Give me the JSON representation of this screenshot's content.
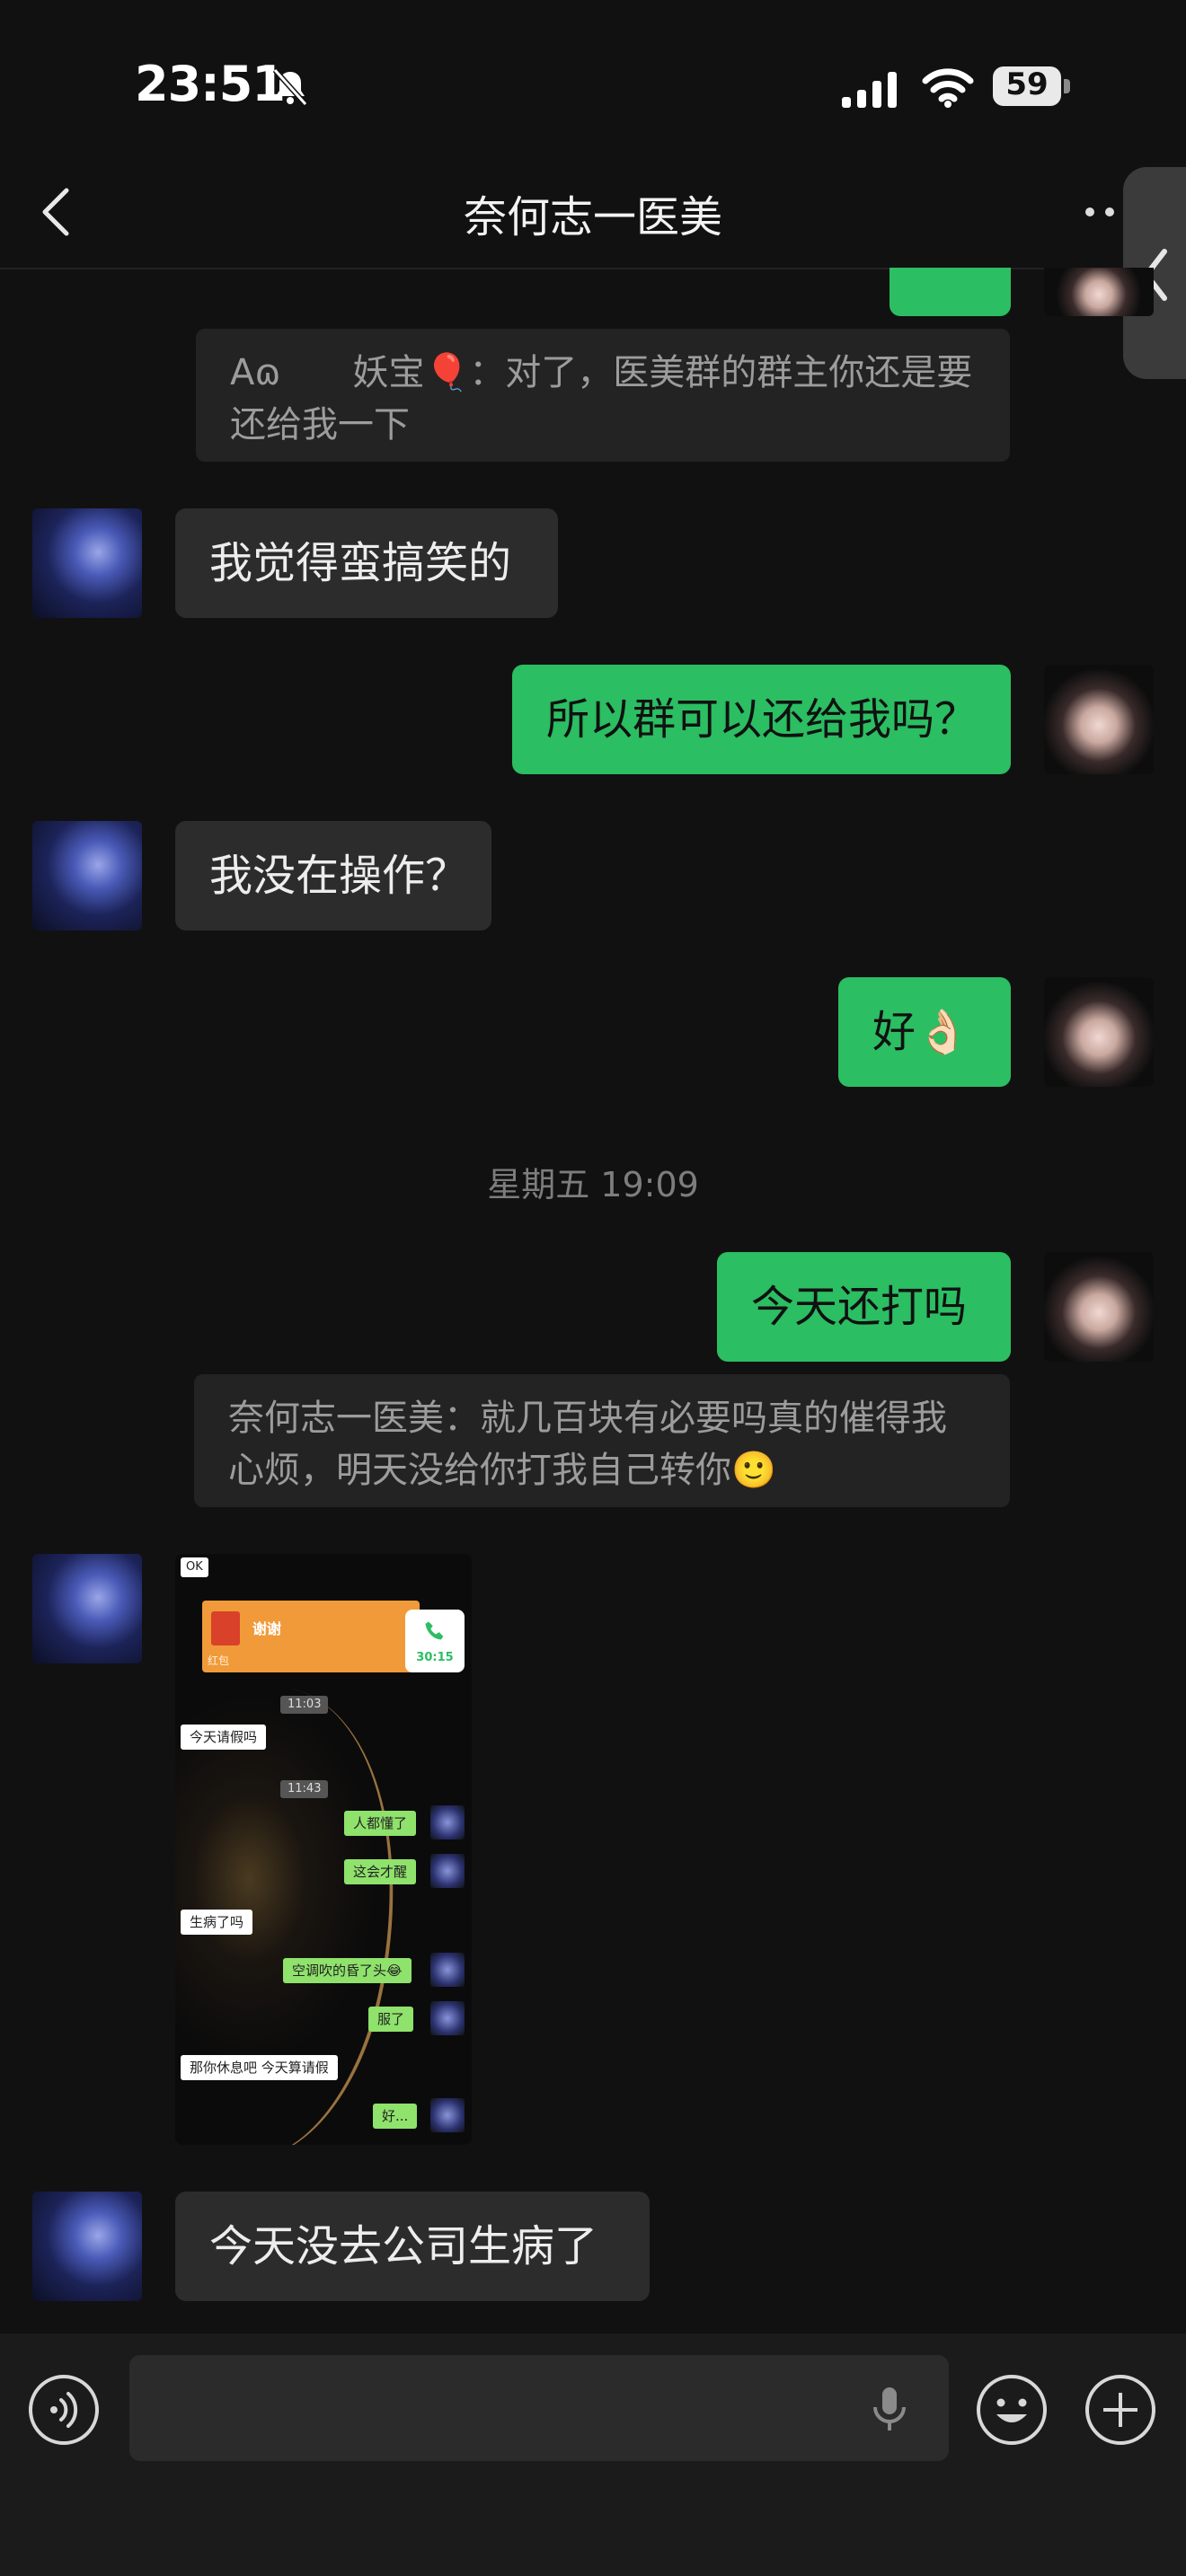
{
  "status_bar": {
    "time": "23:51",
    "battery": "59"
  },
  "nav": {
    "title": "奈何志一医美"
  },
  "messages": [
    {
      "from": "quote",
      "text": "Aɷ　　妖宝🎈：对了，医美群的群主你还是要还给我一下"
    },
    {
      "from": "them",
      "text": "我觉得蛮搞笑的"
    },
    {
      "from": "me",
      "text": "所以群可以还给我吗？"
    },
    {
      "from": "them",
      "text": "我没在操作？"
    },
    {
      "from": "me",
      "text": "好👌🏻"
    },
    {
      "from": "timestamp",
      "text": "星期五 19:09"
    },
    {
      "from": "me",
      "text": "今天还打吗"
    },
    {
      "from": "quote",
      "text": "奈何志一医美：就几百块有必要吗真的催得我心烦，明天没给你打我自己转你🙂"
    },
    {
      "from": "them",
      "text": "今天没去公司生病了"
    }
  ],
  "screenshot": {
    "ok_label": "OK",
    "red_packet_title": "谢谢",
    "red_packet_sub": "红包",
    "call_duration": "30:15",
    "times": [
      "11:03",
      "11:43"
    ],
    "bubbles": [
      {
        "side": "left",
        "text": "今天请假吗"
      },
      {
        "side": "right",
        "text": "人都懂了"
      },
      {
        "side": "right",
        "text": "这会才醒"
      },
      {
        "side": "left",
        "text": "生病了吗"
      },
      {
        "side": "right",
        "text": "空调吹的昏了头😂"
      },
      {
        "side": "right",
        "text": "服了"
      },
      {
        "side": "left",
        "text": "那你休息吧 今天算请假"
      },
      {
        "side": "right",
        "text": "好..."
      }
    ]
  },
  "input": {
    "placeholder": ""
  },
  "colors": {
    "accent_green": "#2bbe62",
    "bubble_dark": "#2c2c2c",
    "background": "#111111"
  },
  "icons": [
    "bell-slash-icon",
    "signal-icon",
    "wifi-icon",
    "battery-icon",
    "back-icon",
    "more-icon",
    "side-chevron-icon",
    "voice-icon",
    "mic-icon",
    "emoji-icon",
    "plus-icon"
  ]
}
